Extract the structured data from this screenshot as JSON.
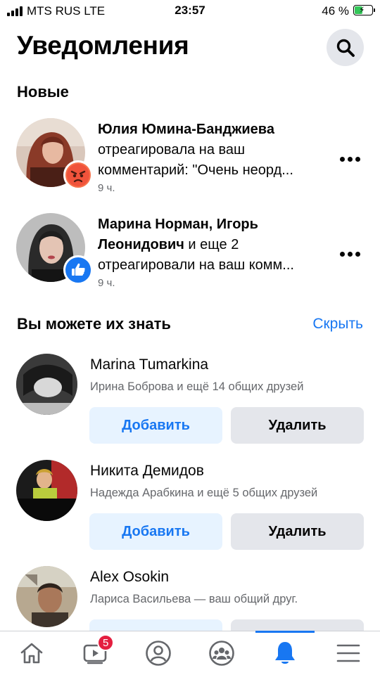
{
  "status_bar": {
    "carrier": "MTS RUS  LTE",
    "time": "23:57",
    "battery": "46 %",
    "battery_level": 0.46
  },
  "header": {
    "title": "Уведомления",
    "search_icon": "search-icon"
  },
  "notifications": {
    "section_title": "Новые",
    "items": [
      {
        "actor": "Юлия Юмина-Банджиева",
        "text": " отреагировала на ваш комментарий: \"Очень неорд...",
        "time": "9 ч.",
        "badge_icon": "angry-reaction-icon",
        "badge_color": "#f7714a"
      },
      {
        "actor": "Марина Норман, Игорь Леонидович",
        "text": " и еще 2 отреагировали на ваш комм...",
        "time": "9 ч.",
        "badge_icon": "like-reaction-icon",
        "badge_color": "#1877f2"
      }
    ]
  },
  "pymk": {
    "section_title": "Вы можете их знать",
    "hide_label": "Скрыть",
    "add_label": "Добавить",
    "remove_label": "Удалить",
    "people": [
      {
        "name": "Marina Tumarkina",
        "mutual": "Ирина Боброва и ещё 14 общих друзей"
      },
      {
        "name": "Никита Демидов",
        "mutual": "Надежда Арабкина и ещё 5 общих друзей"
      },
      {
        "name": "Alex Osokin",
        "mutual": "Лариса Васильева — ваш общий друг."
      }
    ]
  },
  "bottom_nav": {
    "items": [
      "home-icon",
      "watch-icon",
      "profile-icon",
      "groups-icon",
      "notifications-bell-icon",
      "menu-icon"
    ],
    "watch_badge": "5",
    "active": "notifications-bell-icon",
    "accent": "#1877f2"
  }
}
